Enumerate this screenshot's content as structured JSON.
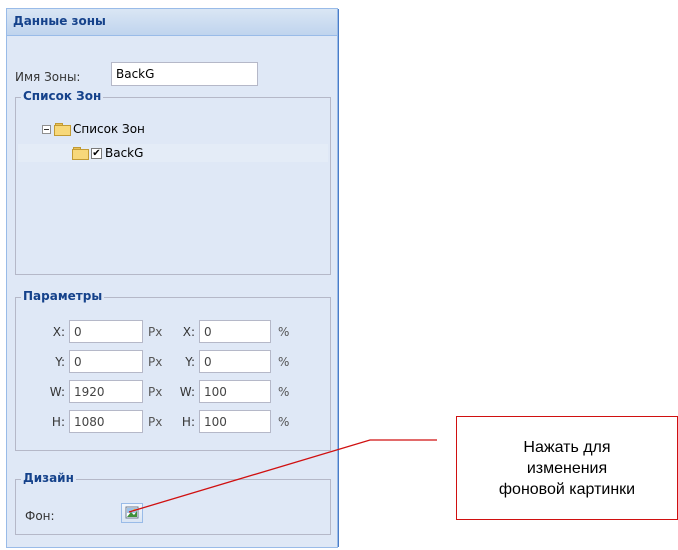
{
  "panel": {
    "title": "Данные зоны"
  },
  "zone_name": {
    "label": "Имя Зоны:",
    "value": "BackG"
  },
  "zone_list": {
    "legend": "Список Зон",
    "root_label": "Список Зон",
    "items": [
      {
        "label": "BackG",
        "checked": true
      }
    ]
  },
  "params": {
    "legend": "Параметры",
    "rows": [
      {
        "label": "X:",
        "px_value": "0",
        "px_unit": "Px",
        "pct_label": "X:",
        "pct_value": "0",
        "pct_unit": "%"
      },
      {
        "label": "Y:",
        "px_value": "0",
        "px_unit": "Px",
        "pct_label": "Y:",
        "pct_value": "0",
        "pct_unit": "%"
      },
      {
        "label": "W:",
        "px_value": "1920",
        "px_unit": "Px",
        "pct_label": "W:",
        "pct_value": "100",
        "pct_unit": "%"
      },
      {
        "label": "H:",
        "px_value": "1080",
        "px_unit": "Px",
        "pct_label": "H:",
        "pct_value": "100",
        "pct_unit": "%"
      }
    ]
  },
  "design": {
    "legend": "Дизайн",
    "background_label": "Фон:",
    "background_button_icon": "image-icon"
  },
  "annotation": {
    "line1": "Нажать для",
    "line2": "изменения",
    "line3": "фоновой картинки",
    "color": "#d01010"
  },
  "colors": {
    "panel_bg": "#dfe8f6",
    "header_text": "#15428b",
    "border": "#99bbe8"
  }
}
